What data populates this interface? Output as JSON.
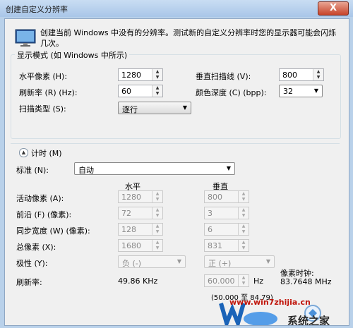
{
  "window": {
    "title": "创建自定义分辨率",
    "close_glyph": "X",
    "intro": "创建当前 Windows 中没有的分辨率。测试新的自定义分辨率时您的显示器可能会闪烁几次。"
  },
  "display_mode": {
    "group_title": "显示模式 (如 Windows 中所示)",
    "h_pixels_label": "水平像素 (H):",
    "h_pixels_value": "1280",
    "v_lines_label": "垂直扫描线 (V):",
    "v_lines_value": "800",
    "refresh_label": "刷新率 (R) (Hz):",
    "refresh_value": "60",
    "color_depth_label": "颜色深度 (C) (bpp):",
    "color_depth_value": "32",
    "scan_type_label": "扫描类型 (S):",
    "scan_type_value": "逐行"
  },
  "timing": {
    "section_title": "计时 (M)",
    "standard_label": "标准 (N):",
    "standard_value": "自动",
    "col_horizontal": "水平",
    "col_vertical": "垂直",
    "rows": [
      {
        "label": "活动像素 (A):",
        "h": "1280",
        "v": "800"
      },
      {
        "label": "前沿 (F) (像素):",
        "h": "72",
        "v": "3"
      },
      {
        "label": "同步宽度 (W) (像素):",
        "h": "128",
        "v": "6"
      },
      {
        "label": "总像素 (X):",
        "h": "1680",
        "v": "831"
      }
    ],
    "polarity_label": "极性 (Y):",
    "polarity_h": "负 (-)",
    "polarity_v": "正 (+)",
    "refresh_label": "刷新率:",
    "refresh_h": "49.86 KHz",
    "refresh_v": "60.000",
    "refresh_unit": "Hz",
    "pixel_clock_label": "像素时钟:",
    "pixel_clock_value": "83.7648 MHz",
    "range_note": "(50.000 至 84.79)"
  },
  "watermark": {
    "url": "www.win7zhijia.cn",
    "brand": "系统之家"
  }
}
